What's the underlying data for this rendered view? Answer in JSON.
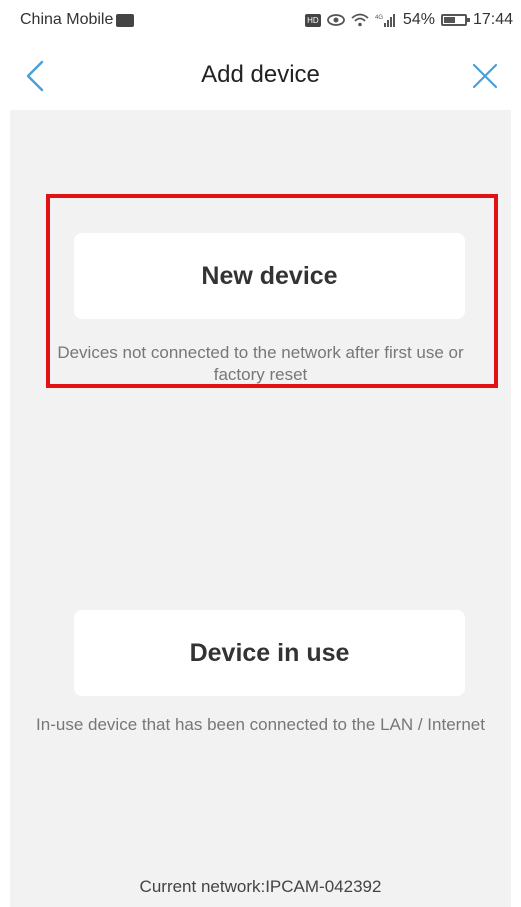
{
  "status_bar": {
    "carrier": "China Mobile",
    "hd_label": "HD",
    "network_type": "4G",
    "battery": "54%",
    "battery_level": 0.54,
    "time": "17:44"
  },
  "nav": {
    "back_icon": "chevron-left-icon",
    "title": "Add device",
    "close_icon": "close-icon",
    "accent_color": "#4a9fd8"
  },
  "options": [
    {
      "label": "New device",
      "description": "Devices not connected to the network after first use or factory reset",
      "highlighted": true
    },
    {
      "label": "Device in use",
      "description": "In-use device that has been connected to the LAN / Internet",
      "highlighted": false
    }
  ],
  "footer": {
    "network": "Current network:IPCAM-042392"
  },
  "colors": {
    "background": "#f2f2f2",
    "card": "#ffffff",
    "highlight": "#e31212"
  }
}
